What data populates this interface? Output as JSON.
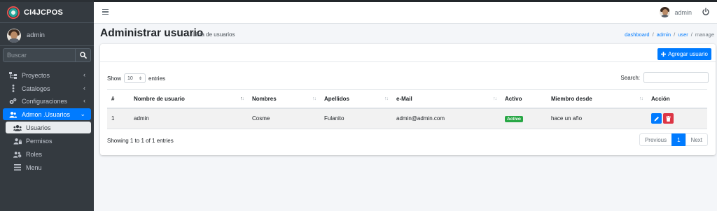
{
  "app": {
    "brand": "CI4JCPOS"
  },
  "sidebar": {
    "user": "admin",
    "search_placeholder": "Buscar",
    "items": [
      {
        "label": "Proyectos",
        "icon": "sitemap-icon"
      },
      {
        "label": "Catalogos",
        "icon": "ellipsis-v-icon"
      },
      {
        "label": "Configuraciones",
        "icon": "cogs-icon"
      },
      {
        "label": "Admon .Usuarios",
        "icon": "users-icon",
        "active": true
      }
    ],
    "subitems": [
      {
        "label": "Usuarios",
        "icon": "users-icon",
        "selected": true
      },
      {
        "label": "Permisos",
        "icon": "user-lock-icon"
      },
      {
        "label": "Roles",
        "icon": "users-cog-icon"
      },
      {
        "label": "Menu",
        "icon": "bars-icon"
      }
    ]
  },
  "topbar": {
    "user": "admin"
  },
  "header": {
    "title": "Administrar usuario",
    "subtitle": "Lista de usuarios",
    "breadcrumb": [
      "dashboard",
      "admin",
      "user",
      "manage"
    ]
  },
  "card": {
    "add_button": "Agregar usuario",
    "show_label": "Show",
    "show_value": "10",
    "entries_label": "entries",
    "search_label": "Search:",
    "columns": [
      "#",
      "Nombre de usuario",
      "Nombres",
      "Apellidos",
      "e-Mail",
      "Activo",
      "Miembro desde",
      "Acción"
    ],
    "rows": [
      {
        "num": "1",
        "username": "admin",
        "nombres": "Cosme",
        "apellidos": "Fulanito",
        "email": "admin@admin.com",
        "activo": "Activo",
        "miembro": "hace un año"
      }
    ],
    "info": "Showing 1 to 1 of 1 entries",
    "pager": {
      "prev": "Previous",
      "page": "1",
      "next": "Next"
    }
  },
  "colors": {
    "primary": "#007bff",
    "sidebar": "#343a40",
    "success": "#28a745",
    "danger": "#dc3545"
  }
}
